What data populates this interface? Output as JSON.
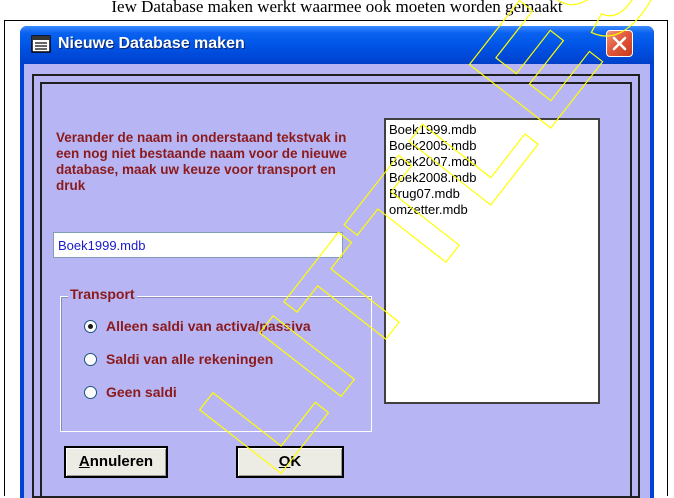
{
  "page": {
    "caption": "Iew Database maken werkt waarmee ook moeten worden gemaakt"
  },
  "window": {
    "title": "Nieuwe Database maken",
    "close_label": "Close",
    "app_icon": "database-icon"
  },
  "dialog": {
    "instructions": "Verander de naam  in onderstaand tekstvak in een nog niet bestaande naam voor de nieuwe database, maak uw keuze voor transport en druk",
    "db_name_value": "Boek1999.mdb",
    "transport": {
      "legend": "Transport",
      "options": [
        {
          "label": "Alleen saldi van activa/passiva",
          "checked": true
        },
        {
          "label": "Saldi van alle rekeningen",
          "checked": false
        },
        {
          "label": "Geen saldi",
          "checked": false
        }
      ]
    },
    "files": [
      "Boek1999.mdb",
      "Boek2005.mdb",
      "Boek2007.mdb",
      "Boek2008.mdb",
      "Brug07.mdb",
      "omzetter.mdb"
    ],
    "buttons": {
      "cancel": {
        "accel": "A",
        "rest": "nnuleren"
      },
      "ok": {
        "accel": "O",
        "rest": "K"
      }
    }
  },
  "watermark": {
    "text": "LITTLES",
    "color": "#ffff00"
  },
  "colors": {
    "titlebar": "#0055e6",
    "client_bg": "#b8b5f5",
    "label_text": "#8b1a1a",
    "input_text": "#1a1acc"
  }
}
